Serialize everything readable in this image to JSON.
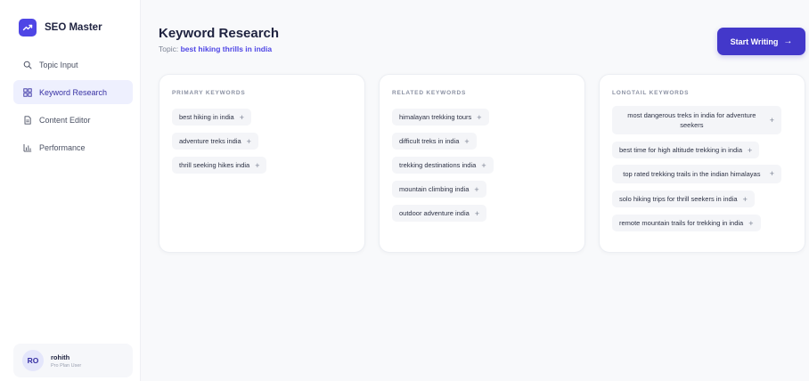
{
  "brand": {
    "name": "SEO Master"
  },
  "nav": {
    "items": [
      {
        "label": "Topic Input",
        "active": false,
        "icon": "search-icon"
      },
      {
        "label": "Keyword Research",
        "active": true,
        "icon": "grid-icon"
      },
      {
        "label": "Content Editor",
        "active": false,
        "icon": "document-icon"
      },
      {
        "label": "Performance",
        "active": false,
        "icon": "chart-icon"
      }
    ]
  },
  "user": {
    "initials": "RO",
    "name": "rohith",
    "role": "Pro Plan User"
  },
  "header": {
    "title": "Keyword Research",
    "topic_label": "Topic: ",
    "topic_value": "best hiking thrills in india",
    "start_button": "Start Writing",
    "start_arrow": "→"
  },
  "cards": {
    "primary": {
      "title": "PRIMARY KEYWORDS",
      "keywords": [
        "best hiking in india",
        "adventure treks india",
        "thrill seeking hikes india"
      ]
    },
    "related": {
      "title": "RELATED KEYWORDS",
      "keywords": [
        "himalayan trekking tours",
        "difficult treks in india",
        "trekking destinations india",
        "mountain climbing india",
        "outdoor adventure india"
      ]
    },
    "longtail": {
      "title": "LONGTAIL KEYWORDS",
      "keywords": [
        "most dangerous treks in india for adventure seekers",
        "best time for high altitude trekking in india",
        "top rated trekking trails in the indian himalayas",
        "solo hiking trips for thrill seekers in india",
        "remote mountain trails for trekking in india"
      ]
    }
  },
  "plus_symbol": "+",
  "colors": {
    "accent": "#4338ca",
    "active_bg": "#eef0fe"
  }
}
